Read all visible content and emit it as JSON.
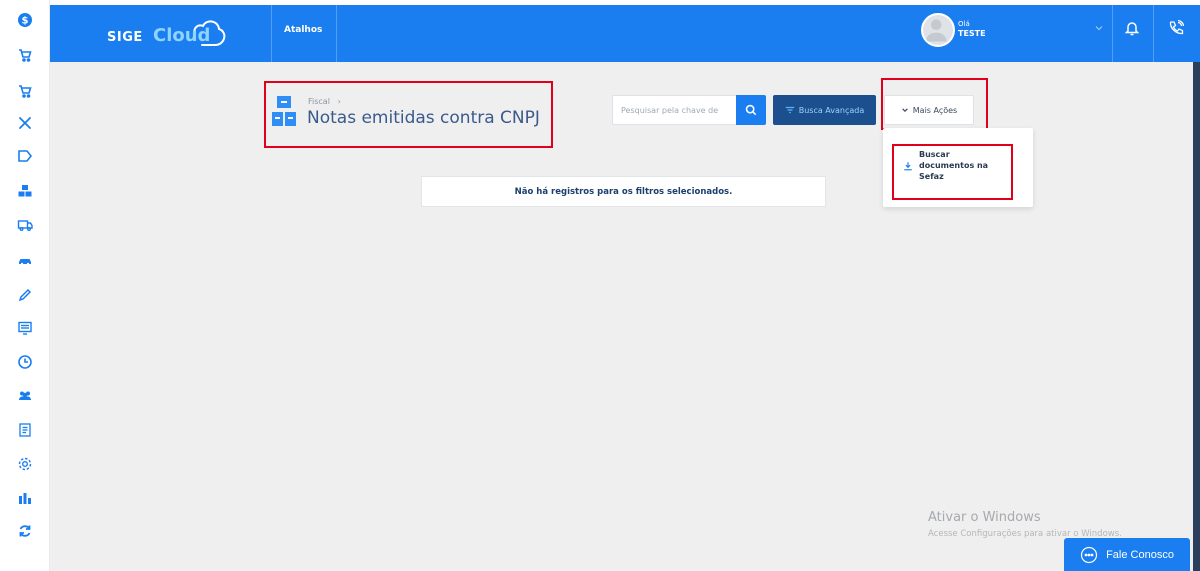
{
  "topbar": {
    "logo_sige": "SIGE",
    "logo_cloud": "Cloud",
    "shortcuts_label": "Atalhos",
    "user_greeting": "Olá",
    "user_name": "TESTE"
  },
  "sidebar": {
    "icons": [
      "dollar-icon",
      "cart-icon",
      "cart-icon",
      "tools-icon",
      "tag-icon",
      "boxes-icon",
      "truck-icon",
      "car-icon",
      "pencil-icon",
      "monitor-icon",
      "clock-icon",
      "users-icon",
      "report-icon",
      "gear-icon",
      "bar-chart-icon",
      "sync-icon"
    ]
  },
  "page": {
    "breadcrumb": "Fiscal",
    "title": "Notas emitidas contra CNPJ"
  },
  "toolbar": {
    "search_placeholder": "Pesquisar pela chave de",
    "advanced_label": "Busca Avançada",
    "more_label": "Mais Ações"
  },
  "dropdown": {
    "item_label": "Buscar documentos na Sefaz"
  },
  "empty_state": {
    "message": "Não há registros para os filtros selecionados."
  },
  "watermark": {
    "title": "Ativar o Windows",
    "subtitle": "Acesse Configurações para ativar o Windows."
  },
  "chat": {
    "label": "Fale Conosco"
  },
  "colors": {
    "primary": "#1a7ef0",
    "navy": "#1c4f8d",
    "title": "#3a5a8c",
    "annotation": "#e0001b"
  }
}
